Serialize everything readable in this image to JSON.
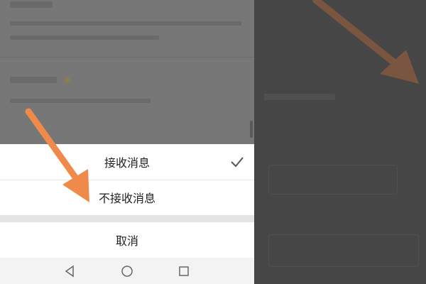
{
  "action_sheet": {
    "options": [
      {
        "label": "接收消息",
        "selected": true
      },
      {
        "label": "不接收消息",
        "selected": false
      }
    ],
    "cancel_label": "取消"
  },
  "icons": {
    "selected_mark": "checkmark-icon",
    "nav_back": "triangle-back-icon",
    "nav_home": "circle-home-icon",
    "nav_recent": "square-recent-icon",
    "annotation": "arrow-pointer-icon"
  },
  "colors": {
    "annotation_arrow": "#f08a4b",
    "sheet_background": "#ffffff",
    "dim_overlay": "#777777"
  }
}
